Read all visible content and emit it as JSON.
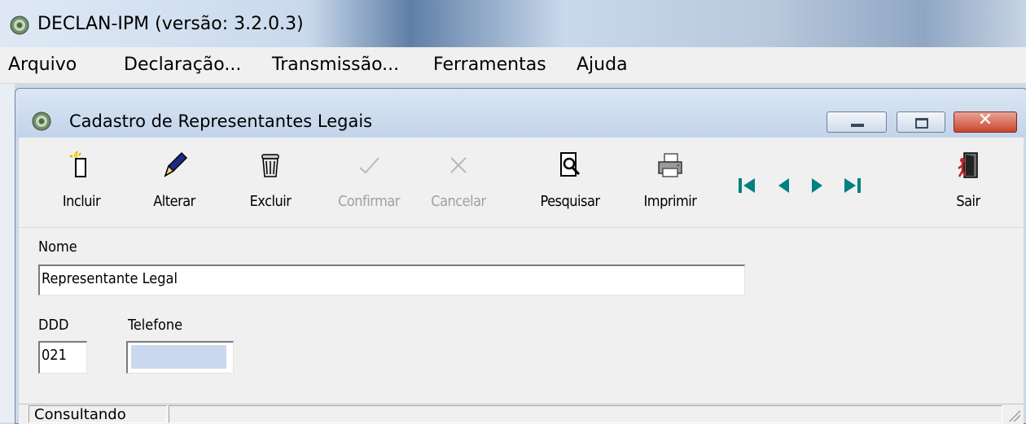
{
  "app": {
    "title": "DECLAN-IPM (versão: 3.2.0.3)"
  },
  "menu": [
    {
      "label": "Arquivo"
    },
    {
      "label": "Declaração..."
    },
    {
      "label": "Transmissão..."
    },
    {
      "label": "Ferramentas"
    },
    {
      "label": "Ajuda"
    }
  ],
  "window": {
    "title": "Cadastro de Representantes Legais",
    "close_glyph": "✕"
  },
  "toolbar": {
    "incluir": "Incluir",
    "alterar": "Alterar",
    "excluir": "Excluir",
    "confirmar": "Confirmar",
    "cancelar": "Cancelar",
    "pesquisar": "Pesquisar",
    "imprimir": "Imprimir",
    "sair": "Sair",
    "nav_color": "#008080"
  },
  "form": {
    "nome_label": "Nome",
    "nome_value": "Representante Legal",
    "ddd_label": "DDD",
    "ddd_value": "021",
    "telefone_label": "Telefone",
    "telefone_value": ""
  },
  "status": {
    "mode": "Consultando"
  }
}
